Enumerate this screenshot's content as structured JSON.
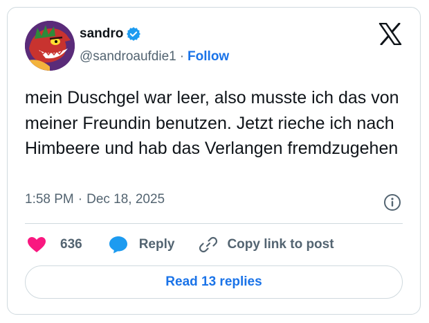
{
  "author": {
    "name": "sandro",
    "handle": "@sandroaufdie1",
    "separator": "·",
    "follow_label": "Follow",
    "verified": true,
    "avatar_icon": "avatar-cartoon-dragon"
  },
  "platform_icon": "x-logo-icon",
  "tweet": {
    "text": "mein Duschgel war leer, also musste ich das von meiner Freundin benutzen. Jetzt rieche ich nach Himbeere und hab das Verlangen fremdzugehen",
    "time": "1:58 PM",
    "separator": "·",
    "date": "Dec 18, 2025"
  },
  "actions": {
    "like_count": "636",
    "reply_label": "Reply",
    "copy_label": "Copy link to post"
  },
  "read_replies_label": "Read 13 replies",
  "colors": {
    "accent": "#1a73e8",
    "heart": "#f91880",
    "reply_bubble": "#1d9bf0",
    "muted_text": "#536471",
    "border": "#cfd9de"
  }
}
